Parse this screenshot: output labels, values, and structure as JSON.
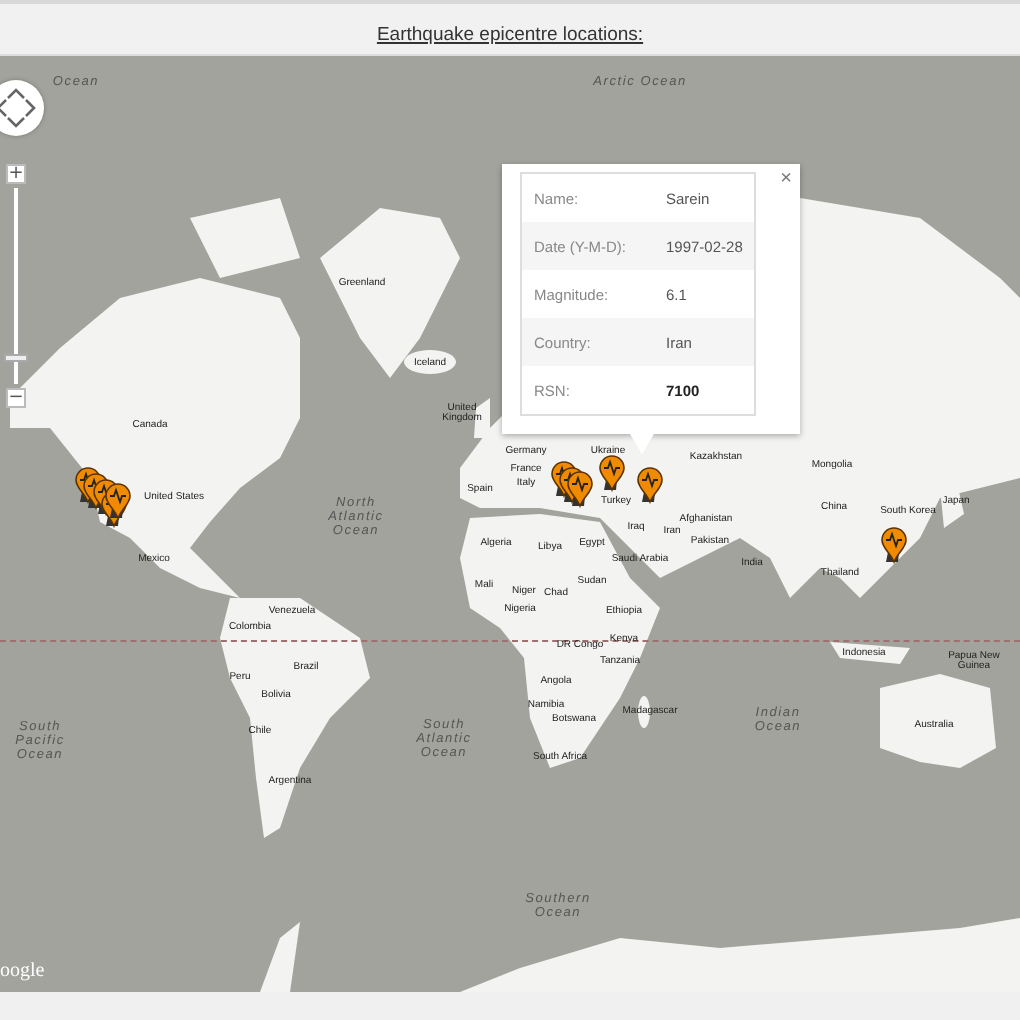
{
  "title": "Earthquake epicentre locations:",
  "map": {
    "attribution": "oogle",
    "zoom": {
      "plus": "+",
      "minus": "−",
      "level": 0.11
    },
    "labels": [
      {
        "text": "Ocean",
        "kind": "ocean"
      },
      {
        "text": "Arctic Ocean",
        "kind": "ocean"
      },
      {
        "text": "Greenland",
        "kind": "country"
      },
      {
        "text": "Iceland",
        "kind": "country"
      },
      {
        "text": "United\nKingdom",
        "kind": "country"
      },
      {
        "text": "Canada",
        "kind": "country"
      },
      {
        "text": "United States",
        "kind": "country"
      },
      {
        "text": "Mexico",
        "kind": "country"
      },
      {
        "text": "North\nAtlantic\nOcean",
        "kind": "ocean"
      },
      {
        "text": "Germany",
        "kind": "country"
      },
      {
        "text": "France",
        "kind": "country"
      },
      {
        "text": "Spain",
        "kind": "country"
      },
      {
        "text": "Italy",
        "kind": "country"
      },
      {
        "text": "Ukraine",
        "kind": "country"
      },
      {
        "text": "Turkey",
        "kind": "country"
      },
      {
        "text": "Kazakhstan",
        "kind": "country"
      },
      {
        "text": "Mongolia",
        "kind": "country"
      },
      {
        "text": "China",
        "kind": "country"
      },
      {
        "text": "South Korea",
        "kind": "country"
      },
      {
        "text": "Japan",
        "kind": "country"
      },
      {
        "text": "Algeria",
        "kind": "country"
      },
      {
        "text": "Libya",
        "kind": "country"
      },
      {
        "text": "Egypt",
        "kind": "country"
      },
      {
        "text": "Iraq",
        "kind": "country"
      },
      {
        "text": "Iran",
        "kind": "country"
      },
      {
        "text": "Afghanistan",
        "kind": "country"
      },
      {
        "text": "Pakistan",
        "kind": "country"
      },
      {
        "text": "Saudi Arabia",
        "kind": "country"
      },
      {
        "text": "India",
        "kind": "country"
      },
      {
        "text": "Thailand",
        "kind": "country"
      },
      {
        "text": "Mali",
        "kind": "country"
      },
      {
        "text": "Niger",
        "kind": "country"
      },
      {
        "text": "Chad",
        "kind": "country"
      },
      {
        "text": "Sudan",
        "kind": "country"
      },
      {
        "text": "Nigeria",
        "kind": "country"
      },
      {
        "text": "Ethiopia",
        "kind": "country"
      },
      {
        "text": "Kenya",
        "kind": "country"
      },
      {
        "text": "DR Congo",
        "kind": "country"
      },
      {
        "text": "Tanzania",
        "kind": "country"
      },
      {
        "text": "Indonesia",
        "kind": "country"
      },
      {
        "text": "Papua New\nGuinea",
        "kind": "country"
      },
      {
        "text": "Angola",
        "kind": "country"
      },
      {
        "text": "Namibia",
        "kind": "country"
      },
      {
        "text": "Botswana",
        "kind": "country"
      },
      {
        "text": "Madagascar",
        "kind": "country"
      },
      {
        "text": "South Africa",
        "kind": "country"
      },
      {
        "text": "Indian\nOcean",
        "kind": "ocean"
      },
      {
        "text": "Australia",
        "kind": "country"
      },
      {
        "text": "Venezuela",
        "kind": "country"
      },
      {
        "text": "Colombia",
        "kind": "country"
      },
      {
        "text": "Peru",
        "kind": "country"
      },
      {
        "text": "Brazil",
        "kind": "country"
      },
      {
        "text": "Bolivia",
        "kind": "country"
      },
      {
        "text": "Chile",
        "kind": "country"
      },
      {
        "text": "Argentina",
        "kind": "country"
      },
      {
        "text": "South\nPacific\nOcean",
        "kind": "ocean"
      },
      {
        "text": "South\nAtlantic\nOcean",
        "kind": "ocean"
      },
      {
        "text": "Southern\nOcean",
        "kind": "ocean"
      }
    ],
    "popup": {
      "close": "×",
      "rows": [
        {
          "label": "Name:",
          "value": "Sarein",
          "bold": false
        },
        {
          "label": "Date (Y-M-D):",
          "value": "1997-02-28",
          "bold": false
        },
        {
          "label": "Magnitude:",
          "value": "6.1",
          "bold": false
        },
        {
          "label": "Country:",
          "value": "Iran",
          "bold": false
        },
        {
          "label": "RSN:",
          "value": "7100",
          "bold": true
        }
      ]
    }
  }
}
